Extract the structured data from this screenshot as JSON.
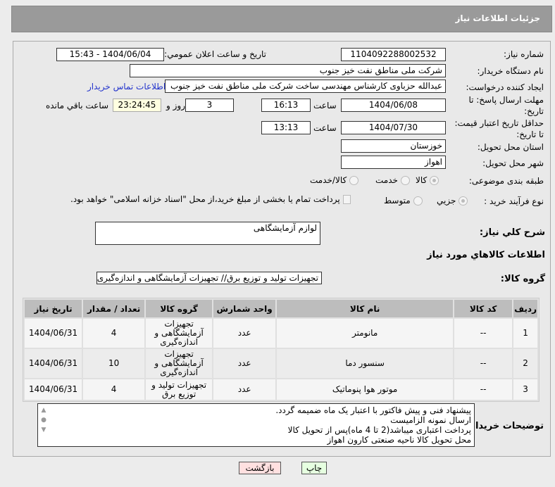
{
  "header": {
    "title": "جزئیات اطلاعات نیاز"
  },
  "form": {
    "need_number_label": "شماره نیاز:",
    "need_number": "1104092288002532",
    "announce_label": "تاریخ و ساعت اعلان عمومي:",
    "announce_value": "1404/06/04 - 15:43",
    "buyer_label": "نام دستگاه خريدار:",
    "buyer": "شرکت ملی مناطق نفت خیز جنوب",
    "creator_label": "ايجاد کننده درخواست:",
    "creator": "عبدالله حزباوی کارشناس مهندسی ساخت شرکت ملی مناطق نفت خیز جنوب",
    "contact_link": "اطلاعات تماس خريدار",
    "deadline_label_1": "مهلت ارسال پاسخ: تا",
    "deadline_label_2": "تاریخ:",
    "deadline_date": "1404/06/08",
    "time_label": "ساعت",
    "deadline_time": "16:13",
    "days": "3",
    "days_label": "روز و",
    "remaining": "23:24:45",
    "remaining_label": "ساعت باقي مانده",
    "validity_label_1": "حداقل تاريخ اعتبار قيمت:",
    "validity_label_2": "تا تاريخ:",
    "validity_date": "1404/07/30",
    "validity_time": "13:13",
    "province_label": "استان محل تحويل:",
    "province": "خوزستان",
    "city_label": "شهر محل تحويل:",
    "city": "اهواز",
    "category_label": "طبقه بندی موضوعی:",
    "category_options": [
      "کالا",
      "خدمت",
      "کالا/خدمت"
    ],
    "category_selected": "کالا",
    "process_label": "نوع فرآيند خريد :",
    "process_options": [
      "جزيي",
      "متوسط"
    ],
    "process_selected": "جزيي",
    "payment_note": "پرداخت تمام يا بخشی از مبلغ خريد،از محل \"اسناد خزانه اسلامی\" خواهد بود.",
    "description_label": "شرح کلي نياز:",
    "description": "لوازم آزمایشگاهی",
    "goods_section": "اطلاعات کالاهاي مورد نياز",
    "goods_group_label": "گروه کالا:",
    "goods_group": "تجهیزات تولید و توزیع برق// تجهیزات آزمایشگاهی و اندازه‌گیری"
  },
  "table": {
    "columns": [
      "رديف",
      "کد کالا",
      "نام کالا",
      "واحد شمارش",
      "گروه کالا",
      "تعداد / مقدار",
      "تاريخ نياز"
    ],
    "rows": [
      [
        "1",
        "--",
        "مانومتر",
        "عدد",
        "تجهیزات آزمایشگاهی و اندازه‌گیری",
        "4",
        "1404/06/31"
      ],
      [
        "2",
        "--",
        "سنسور دما",
        "عدد",
        "تجهیزات آزمایشگاهی و اندازه‌گیری",
        "10",
        "1404/06/31"
      ],
      [
        "3",
        "--",
        "موتور هوا پنوماتیک",
        "عدد",
        "تجهیزات تولید و توزیع برق",
        "4",
        "1404/06/31"
      ]
    ]
  },
  "notes": {
    "label": "توضيحات خريدار:",
    "lines": [
      "پیشنهاد فنی و پیش فاکتور با اعتبار یک ماه ضمیمه گردد.",
      "ارسال نمونه الزامیست",
      "پرداخت اعتباری میباشد(2 تا 4 ماه)پس از تحویل کالا",
      "محل تحویل کالا ناحیه صنعتی کارون اهواز"
    ]
  },
  "buttons": {
    "print": "چاپ",
    "back": "بازگشت"
  },
  "colors": {
    "print_bg": "#e6ffe0",
    "back_bg": "#ffe0e0",
    "remaining_bg": "#ffffe0",
    "link": "#2233cc"
  }
}
